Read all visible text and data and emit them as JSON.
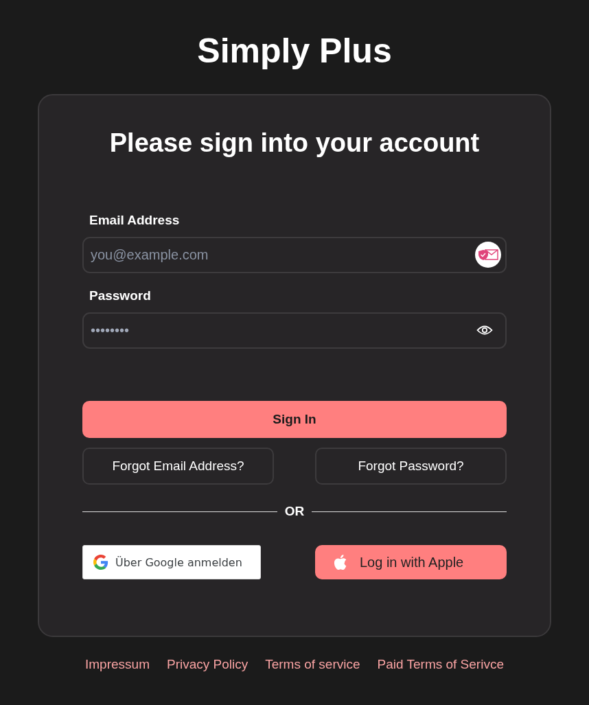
{
  "app_title": "Simply Plus",
  "heading": "Please sign into your account",
  "fields": [
    {
      "label": "Email Address",
      "placeholder": "you@example.com",
      "kind": "email"
    },
    {
      "label": "Password",
      "value": "••••••••",
      "kind": "password"
    }
  ],
  "sign_in": "Sign In",
  "forgot": [
    "Forgot Email Address?",
    "Forgot Password?"
  ],
  "divider": "OR",
  "google_button": "Über Google anmelden",
  "apple_button": "Log in with Apple",
  "footer_links": [
    "Impressum",
    "Privacy Policy",
    "Terms of service",
    "Paid Terms of Serivce"
  ]
}
